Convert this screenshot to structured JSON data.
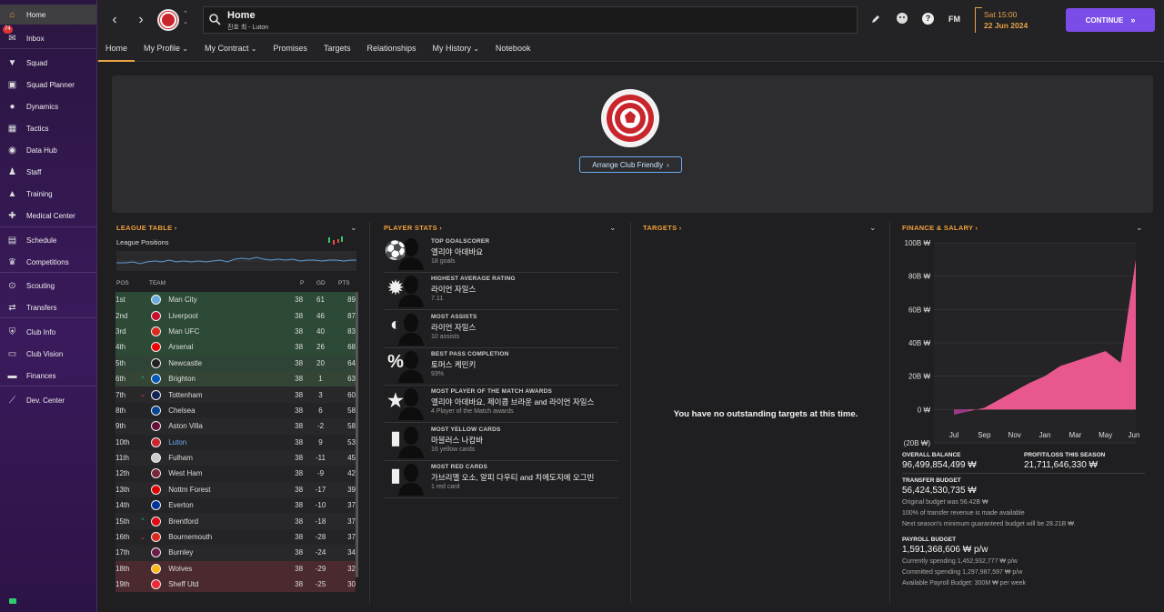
{
  "sidebar": {
    "items": [
      {
        "label": "Home",
        "icon": "home-icon",
        "active": true
      },
      {
        "label": "Inbox",
        "icon": "inbox-icon",
        "badge": "74"
      },
      {
        "label": "Squad",
        "icon": "shirt-icon"
      },
      {
        "label": "Squad Planner",
        "icon": "planner-icon"
      },
      {
        "label": "Dynamics",
        "icon": "dynamics-icon"
      },
      {
        "label": "Tactics",
        "icon": "tactics-icon"
      },
      {
        "label": "Data Hub",
        "icon": "data-hub-icon"
      },
      {
        "label": "Staff",
        "icon": "staff-icon"
      },
      {
        "label": "Training",
        "icon": "training-icon"
      },
      {
        "label": "Medical Center",
        "icon": "medical-icon"
      },
      {
        "label": "Schedule",
        "icon": "calendar-icon"
      },
      {
        "label": "Competitions",
        "icon": "trophy-icon"
      },
      {
        "label": "Scouting",
        "icon": "scouting-icon"
      },
      {
        "label": "Transfers",
        "icon": "transfers-icon"
      },
      {
        "label": "Club Info",
        "icon": "shield-icon"
      },
      {
        "label": "Club Vision",
        "icon": "vision-icon"
      },
      {
        "label": "Finances",
        "icon": "finances-icon"
      },
      {
        "label": "Dev. Center",
        "icon": "dev-center-icon"
      }
    ]
  },
  "header": {
    "title": "Home",
    "subtitle": "진호 최 - Luton",
    "fm_label": "FM",
    "date_time": "Sat 15:00",
    "date": "22 Jun 2024",
    "continue_label": "CONTINUE"
  },
  "tabs": [
    {
      "label": "Home",
      "active": true,
      "dropdown": false
    },
    {
      "label": "My Profile",
      "dropdown": true
    },
    {
      "label": "My Contract",
      "dropdown": true
    },
    {
      "label": "Promises",
      "dropdown": false
    },
    {
      "label": "Targets",
      "dropdown": false
    },
    {
      "label": "Relationships",
      "dropdown": false
    },
    {
      "label": "My History",
      "dropdown": true
    },
    {
      "label": "Notebook",
      "dropdown": false
    }
  ],
  "hero": {
    "arrange_label": "Arrange Club Friendly"
  },
  "league_table": {
    "title": "LEAGUE TABLE",
    "positions_label": "League Positions",
    "headers": {
      "pos": "POS",
      "team": "TEAM",
      "p": "P",
      "gd": "GD",
      "pts": "PTS"
    },
    "rows": [
      {
        "pos": "1st",
        "team": "Man City",
        "p": "38",
        "gd": "61",
        "pts": "89",
        "zone": "cl",
        "trend": ""
      },
      {
        "pos": "2nd",
        "team": "Liverpool",
        "p": "38",
        "gd": "46",
        "pts": "87",
        "zone": "cl",
        "trend": ""
      },
      {
        "pos": "3rd",
        "team": "Man UFC",
        "p": "38",
        "gd": "40",
        "pts": "83",
        "zone": "cl",
        "trend": ""
      },
      {
        "pos": "4th",
        "team": "Arsenal",
        "p": "38",
        "gd": "26",
        "pts": "68",
        "zone": "cl",
        "trend": ""
      },
      {
        "pos": "5th",
        "team": "Newcastle",
        "p": "38",
        "gd": "20",
        "pts": "64",
        "zone": "el",
        "trend": ""
      },
      {
        "pos": "6th",
        "team": "Brighton",
        "p": "38",
        "gd": "1",
        "pts": "63",
        "zone": "ecl",
        "trend": "up"
      },
      {
        "pos": "7th",
        "team": "Tottenham",
        "p": "38",
        "gd": "3",
        "pts": "60",
        "zone": "",
        "trend": "down"
      },
      {
        "pos": "8th",
        "team": "Chelsea",
        "p": "38",
        "gd": "6",
        "pts": "58",
        "zone": "",
        "trend": ""
      },
      {
        "pos": "9th",
        "team": "Aston Villa",
        "p": "38",
        "gd": "-2",
        "pts": "58",
        "zone": "",
        "trend": ""
      },
      {
        "pos": "10th",
        "team": "Luton",
        "p": "38",
        "gd": "9",
        "pts": "53",
        "zone": "",
        "trend": "",
        "highlight": true
      },
      {
        "pos": "11th",
        "team": "Fulham",
        "p": "38",
        "gd": "-11",
        "pts": "45",
        "zone": "",
        "trend": ""
      },
      {
        "pos": "12th",
        "team": "West Ham",
        "p": "38",
        "gd": "-9",
        "pts": "42",
        "zone": "",
        "trend": ""
      },
      {
        "pos": "13th",
        "team": "Nottm Forest",
        "p": "38",
        "gd": "-17",
        "pts": "39",
        "zone": "",
        "trend": ""
      },
      {
        "pos": "14th",
        "team": "Everton",
        "p": "38",
        "gd": "-10",
        "pts": "37",
        "zone": "",
        "trend": ""
      },
      {
        "pos": "15th",
        "team": "Brentford",
        "p": "38",
        "gd": "-18",
        "pts": "37",
        "zone": "",
        "trend": "up"
      },
      {
        "pos": "16th",
        "team": "Bournemouth",
        "p": "38",
        "gd": "-28",
        "pts": "37",
        "zone": "",
        "trend": "down"
      },
      {
        "pos": "17th",
        "team": "Burnley",
        "p": "38",
        "gd": "-24",
        "pts": "34",
        "zone": "",
        "trend": ""
      },
      {
        "pos": "18th",
        "team": "Wolves",
        "p": "38",
        "gd": "-29",
        "pts": "32",
        "zone": "rel",
        "trend": ""
      },
      {
        "pos": "19th",
        "team": "Sheff Utd",
        "p": "38",
        "gd": "-25",
        "pts": "30",
        "zone": "rel",
        "trend": ""
      }
    ]
  },
  "player_stats": {
    "title": "PLAYER STATS",
    "items": [
      {
        "label": "TOP GOALSCORER",
        "name": "엘리야 아데바요",
        "sub": "18 goals",
        "icon": "football-icon"
      },
      {
        "label": "HIGHEST AVERAGE RATING",
        "name": "라이언 자일스",
        "sub": "7.11",
        "icon": "rating-badge-icon"
      },
      {
        "label": "MOST ASSISTS",
        "name": "라이언 자일스",
        "sub": "10 assists",
        "icon": "assist-icon"
      },
      {
        "label": "BEST PASS COMPLETION",
        "name": "토머스 케민키",
        "sub": "93%",
        "icon": "percent-icon"
      },
      {
        "label": "MOST PLAYER OF THE MATCH AWARDS",
        "name": "엘리야 아데바요, 제이콥 브라운 and 라이언 자일스",
        "sub": "4 Player of the Match awards",
        "icon": "star-icon"
      },
      {
        "label": "MOST YELLOW CARDS",
        "name": "마블러스 나캄바",
        "sub": "16 yellow cards",
        "icon": "yellow-card-icon"
      },
      {
        "label": "MOST RED CARDS",
        "name": "가브리엘 오소, 알피 다우티 and 치에도지에 오그빈",
        "sub": "1 red card",
        "icon": "red-card-icon"
      }
    ]
  },
  "targets": {
    "title": "TARGETS",
    "empty": "You have no outstanding targets at this time."
  },
  "finance": {
    "title": "FINANCE & SALARY",
    "overall_balance_label": "OVERALL BALANCE",
    "overall_balance": "96,499,854,499 ₩",
    "profit_label": "PROFIT/LOSS THIS SEASON",
    "profit": "21,711,646,330 ₩",
    "transfer_label": "TRANSFER BUDGET",
    "transfer": "56,424,530,735 ₩",
    "transfer_notes": [
      "Original budget was 56.42B ₩",
      "100% of transfer revenue is made available",
      "Next season's minimum guaranteed budget will be 28.21B ₩."
    ],
    "payroll_label": "PAYROLL BUDGET",
    "payroll": "1,591,368,606 ₩ p/w",
    "payroll_notes": [
      "Currently spending 1,452,932,777 ₩ p/w",
      "Committed spending 1,297,987,597 ₩ p/w",
      "Available Payroll Budget: 300M ₩ per week"
    ]
  },
  "chart_data": {
    "type": "area",
    "title": "",
    "x": [
      "Jul",
      "Aug",
      "Sep",
      "Oct",
      "Nov",
      "Dec",
      "Jan",
      "Feb",
      "Mar",
      "Apr",
      "May",
      "Jun",
      "Jun-end"
    ],
    "xticks": [
      "Jul",
      "Sep",
      "Nov",
      "Jan",
      "Mar",
      "May",
      "Jun"
    ],
    "values": [
      -3,
      -1,
      1,
      6,
      11,
      16,
      20,
      26,
      29,
      32,
      35,
      28,
      90
    ],
    "ylim": [
      -20,
      100
    ],
    "yticks": [
      "100B ₩",
      "80B ₩",
      "60B ₩",
      "40B ₩",
      "20B ₩",
      "0 ₩",
      "(20B ₩)"
    ],
    "ytick_values": [
      100,
      80,
      60,
      40,
      20,
      0,
      -20
    ],
    "ylabel": "",
    "xlabel": "",
    "grid": true,
    "color": "#e8588f",
    "negative_color": "#9a3a8a"
  },
  "colors": {
    "accent": "#e8a245",
    "brand": "#7b4de8",
    "link": "#6aaaf0"
  }
}
